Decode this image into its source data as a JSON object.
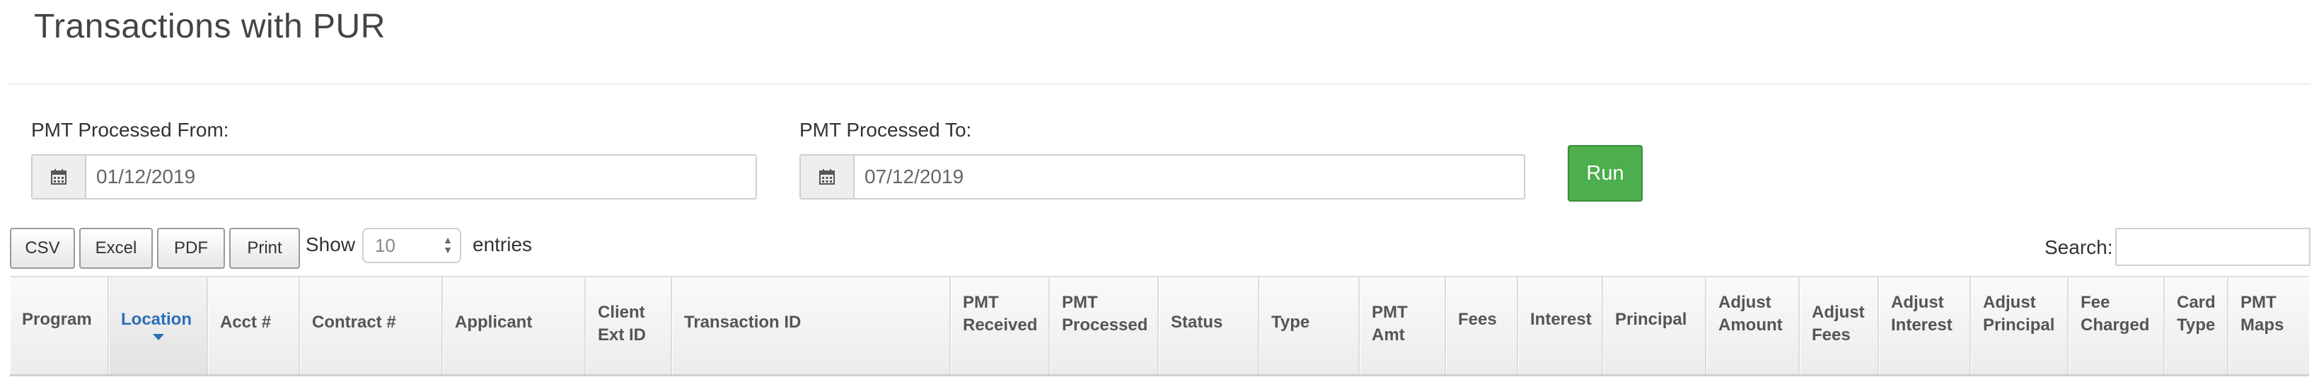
{
  "page": {
    "title": "Transactions with PUR"
  },
  "filters": {
    "from_label": "PMT Processed From:",
    "from_value": "01/12/2019",
    "to_label": "PMT Processed To:",
    "to_value": "07/12/2019",
    "run_label": "Run"
  },
  "toolbar": {
    "buttons": [
      "CSV",
      "Excel",
      "PDF",
      "Print"
    ],
    "show_label": "Show",
    "page_length": "10",
    "entries_label": "entries",
    "search_label": "Search:",
    "search_value": ""
  },
  "table": {
    "sorted_column": "Location",
    "columns": [
      "Program",
      "Location",
      "Acct #",
      "Contract #",
      "Applicant",
      "Client Ext ID",
      "Transaction ID",
      "PMT Received",
      "PMT Processed",
      "Status",
      "Type",
      "PMT Amt",
      "Fees",
      "Interest",
      "Principal",
      "Adjust Amount",
      "Adjust Fees",
      "Adjust Interest",
      "Adjust Principal",
      "Fee Charged",
      "Card Type",
      "PMT Maps"
    ]
  },
  "icons": {
    "date_addon": "calendar-icon",
    "sort_indicator": "sort-desc-icon"
  },
  "colors": {
    "run_button": "#4cae4c",
    "sorted_header": "#2a6fb8"
  }
}
